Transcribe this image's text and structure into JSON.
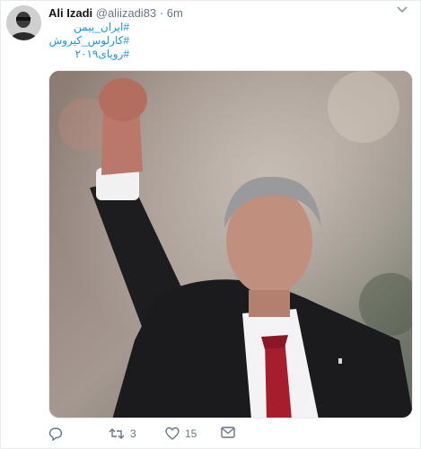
{
  "tweet": {
    "author_name": "Ali Izadi",
    "handle": "@aliizadi83",
    "separator": "·",
    "time": "6m",
    "hashtags": [
      "#ایران_پیمن",
      "#کارلوس_کیروش",
      "#رویای۲۰۱۹"
    ],
    "actions": {
      "reply_count": "",
      "retweet_count": "3",
      "like_count": "15"
    }
  },
  "colors": {
    "link": "#1b95e0",
    "muted": "#657786"
  }
}
